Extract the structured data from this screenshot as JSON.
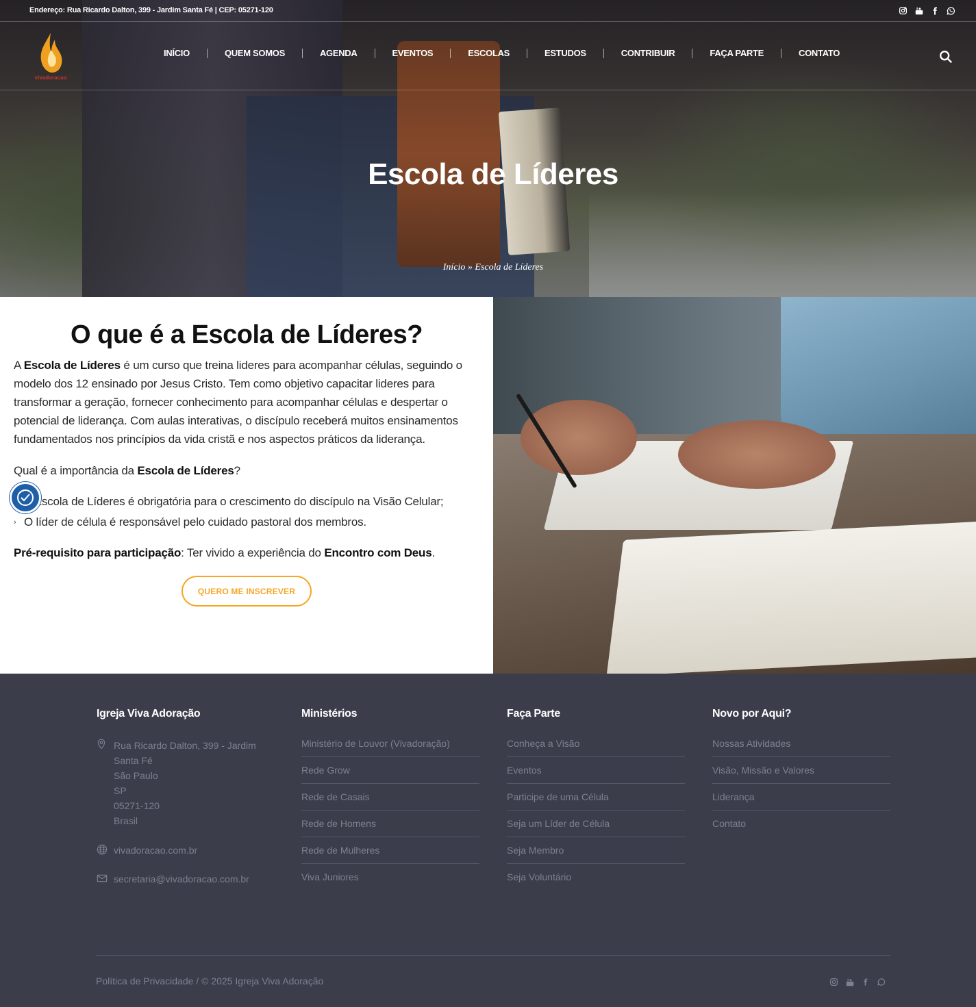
{
  "topbar": {
    "address": "Endereço: Rua Ricardo Dalton, 399 - Jardim Santa Fé | CEP: 05271-120",
    "social_icons": [
      "instagram-icon",
      "youtube-icon",
      "facebook-icon",
      "whatsapp-icon"
    ]
  },
  "logo": {
    "text": "vivadoracao"
  },
  "nav": {
    "items": [
      "INÍCIO",
      "QUEM SOMOS",
      "AGENDA",
      "EVENTOS",
      "ESCOLAS",
      "ESTUDOS",
      "CONTRIBUIR",
      "FAÇA PARTE",
      "CONTATO"
    ]
  },
  "hero": {
    "title": "Escola de Líderes",
    "breadcrumb_home": "Início",
    "breadcrumb_sep": "»",
    "breadcrumb_current": "Escola de Líderes"
  },
  "main": {
    "title": "O que é a Escola de Líderes?",
    "p1_a": "A ",
    "p1_b": "Escola de Líderes",
    "p1_c": " é um curso que treina lideres para acompanhar células, seguindo o modelo dos 12 ensinado por Jesus Cristo. Tem como objetivo capacitar lideres para transformar a geração, fornecer conhecimento para acompanhar células e despertar o potencial de liderança. Com aulas interativas, o discípulo receberá muitos ensinamentos fundamentados nos princípios da vida cristã e nos aspectos práticos da liderança.",
    "p2_a": "Qual é a importância da ",
    "p2_b": "Escola de Líderes",
    "p2_c": "?",
    "bullet1": "A Escola de Líderes é obrigatória para o crescimento do discípulo na Visão Celular;",
    "bullet2": "O líder de célula é responsável pelo cuidado pastoral dos membros.",
    "p3_a": "Pré-requisito para participação",
    "p3_b": ": Ter vivido a experiência do ",
    "p3_c": "Encontro com Deus",
    "p3_d": ".",
    "cta": "QUERO ME INSCREVER"
  },
  "footer": {
    "col1": {
      "title": "Igreja Viva Adoração",
      "address": [
        "Rua Ricardo Dalton, 399 - Jardim",
        "Santa Fé",
        "São Paulo",
        "SP",
        "05271-120",
        "Brasil"
      ],
      "website": "vivadoracao.com.br",
      "email": "secretaria@vivadoracao.com.br"
    },
    "col2": {
      "title": "Ministérios",
      "links": [
        "Ministério de Louvor (Vivadoração)",
        "Rede Grow",
        "Rede de Casais",
        "Rede de Homens",
        "Rede de Mulheres",
        "Viva Juniores"
      ]
    },
    "col3": {
      "title": "Faça Parte",
      "links": [
        "Conheça a Visão",
        "Eventos",
        "Participe de uma Célula",
        "Seja um Líder de Célula",
        "Seja Membro",
        "Seja Voluntário"
      ]
    },
    "col4": {
      "title": "Novo por Aqui?",
      "links": [
        "Nossas Atividades",
        "Visão, Missão e Valores",
        "Liderança",
        "Contato"
      ]
    },
    "copyright": "Política de Privacidade / © 2025 Igreja Viva Adoração"
  },
  "colors": {
    "accent": "#f5a623",
    "footer_bg": "#3b3d4b",
    "a11y": "#1f5fa8"
  }
}
